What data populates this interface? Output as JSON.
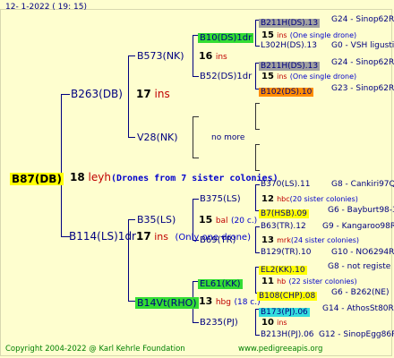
{
  "header": {
    "date": "12-  1-2022 ( 19: 15)"
  },
  "footer": {
    "copyright": "Copyright 2004-2022 @ Karl Kehrle Foundation",
    "url": "www.pedigreeapis.org"
  },
  "colors": {
    "background": "#fefecf",
    "line": "#000080",
    "highlight_yellow": "#ffff00",
    "highlight_green": "#33dd33",
    "highlight_gray": "#a0a0a0",
    "highlight_orange": "#ff8c00",
    "highlight_cyan": "#33dddd"
  },
  "root": {
    "name": "B87(DB)",
    "num": "18",
    "code": "leyh",
    "note": "(Drones from 7 sister colonies)"
  },
  "l1": [
    {
      "name": "B263(DB)",
      "num": "17",
      "code": "ins"
    },
    {
      "name": "B114(LS)1dr",
      "num": "17",
      "code": "ins",
      "note": "(Only one drone)"
    }
  ],
  "l2": [
    {
      "name": "B573(NK)",
      "num": "16",
      "code": "ins"
    },
    {
      "name": "V28(NK)",
      "more": "no more"
    },
    {
      "name": "B35(LS)",
      "num": "15",
      "code": "bal",
      "note": "(20 c.)"
    },
    {
      "name": "B14Vt(RHO)",
      "num": "13",
      "code": "hbg",
      "note": "(18 c.)"
    }
  ],
  "l3": [
    {
      "name": "B10(DS)1dr",
      "num": "15",
      "code": "ins",
      "note": "(One single drone)"
    },
    {
      "name": "B52(DS)1dr",
      "num": "15",
      "code": "ins",
      "note": "(One single drone)"
    },
    {
      "name": "B375(LS)",
      "num": "12",
      "code": "hbc",
      "note": "(20 sister colonies)"
    },
    {
      "name": "B69(TR)",
      "num": "13",
      "code": "mrk",
      "note": "(24 sister colonies)"
    },
    {
      "name": "EL61(KK)",
      "num": "11",
      "code": "hb",
      "note": "(22 sister colonies)"
    },
    {
      "name": "B235(PJ)",
      "num": "10",
      "code": "ins"
    }
  ],
  "l4": [
    {
      "name": "B211H(DS).13",
      "group": "G24 - Sinop62R"
    },
    {
      "name": "L302H(DS).13",
      "group": "G0 - VSH ligusti"
    },
    {
      "name": "B211H(DS).13",
      "group": "G24 - Sinop62R"
    },
    {
      "name": "B102(DS).10",
      "group": "G23 - Sinop62R"
    },
    {
      "name": "B370(LS).11",
      "group": "G8 - Cankiri97Q"
    },
    {
      "name": "B7(HSB).09",
      "group": "G6 - Bayburt98-3"
    },
    {
      "name": "B63(TR).12",
      "group": "G9 - Kangaroo98R"
    },
    {
      "name": "B129(TR).10",
      "group": "G10 - NO6294R"
    },
    {
      "name": "EL2(KK).10",
      "group": "G8 - not registe"
    },
    {
      "name": "B108(CHP).08",
      "group": "G6 - B262(NE)"
    },
    {
      "name": "B173(PJ).06",
      "group": "G14 - AthosSt80R"
    },
    {
      "name": "B213H(PJ).06",
      "group": "G12 - SinopEgg86R"
    }
  ]
}
